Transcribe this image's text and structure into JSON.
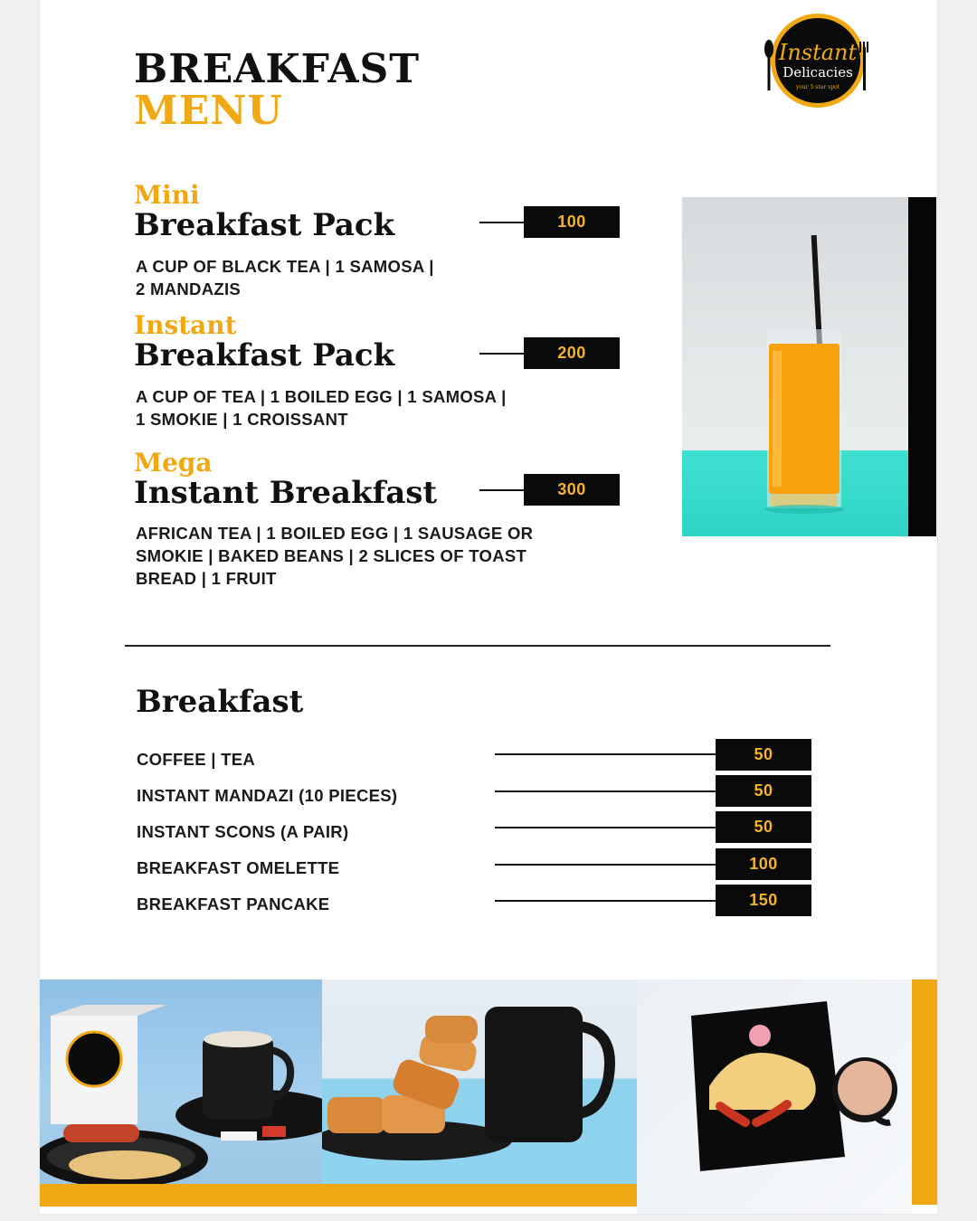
{
  "colors": {
    "accent": "#f0a914",
    "dark": "#0a0a0a",
    "price_text": "#f4b42a"
  },
  "header": {
    "title_line1": "BREAKFAST",
    "title_line2": "MENU"
  },
  "logo": {
    "line1": "Instant",
    "line2": "Delicacies",
    "tagline": "your 5 star spot"
  },
  "packs": [
    {
      "prefix": "Mini",
      "name": "Breakfast Pack",
      "price": "100",
      "desc_line1": "A CUP OF BLACK TEA | 1 SAMOSA |",
      "desc_line2": "2 MANDAZIS"
    },
    {
      "prefix": "Instant",
      "name": "Breakfast Pack",
      "price": "200",
      "desc_line1": "A CUP OF TEA | 1 BOILED EGG | 1 SAMOSA |",
      "desc_line2": "1 SMOKIE | 1 CROISSANT"
    },
    {
      "prefix": "Mega",
      "name": "Instant Breakfast",
      "price": "300",
      "desc_line1": "AFRICAN TEA | 1 BOILED EGG | 1 SAUSAGE OR",
      "desc_line2": "SMOKIE | BAKED BEANS | 2 SLICES OF TOAST",
      "desc_line3": "BREAD | 1 FRUIT"
    }
  ],
  "breakfast": {
    "title": "Breakfast",
    "items": [
      {
        "label": "COFFEE | TEA",
        "price": "50"
      },
      {
        "label": "INSTANT MANDAZI (10 PIECES)",
        "price": "50"
      },
      {
        "label": "INSTANT SCONS (A PAIR)",
        "price": "50"
      },
      {
        "label": "BREAKFAST OMELETTE",
        "price": "100"
      },
      {
        "label": "BREAKFAST PANCAKE",
        "price": "150"
      }
    ]
  },
  "photos": {
    "juice": "glass-of-orange-juice",
    "tea_set": "tea-cup-with-omelette-and-sausage",
    "scones": "scones-with-black-mug",
    "plate": "omelette-and-sausages-with-tea"
  }
}
